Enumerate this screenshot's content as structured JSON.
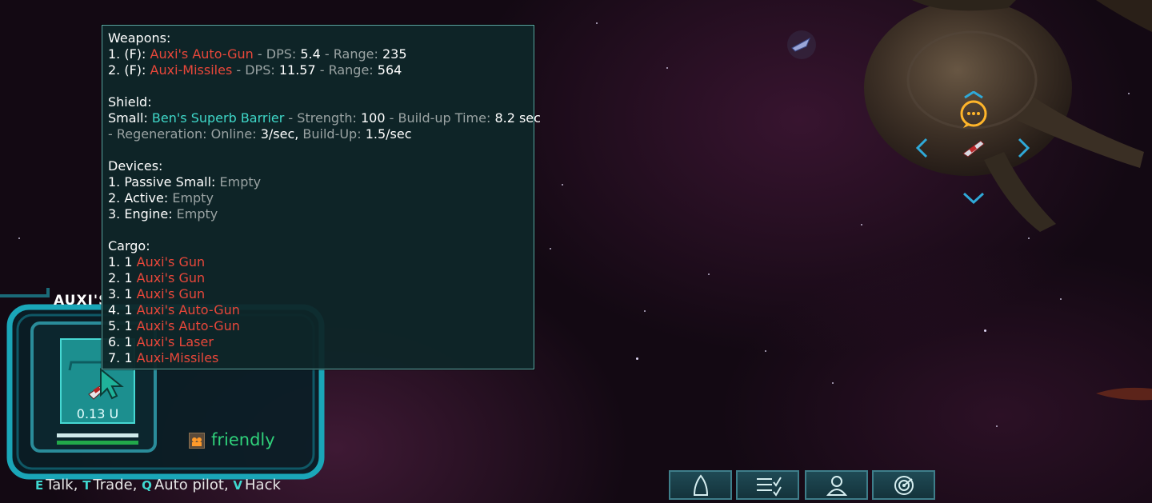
{
  "tooltip": {
    "weapons_header": "Weapons:",
    "weapons": [
      {
        "prefix": "1. (F): ",
        "name": "Auxi's Auto-Gun",
        "dps_label": " - DPS: ",
        "dps": "5.4",
        "range_label": " - Range: ",
        "range": "235"
      },
      {
        "prefix": "2. (F): ",
        "name": "Auxi-Missiles",
        "dps_label": " - DPS: ",
        "dps": "11.57",
        "range_label": " - Range: ",
        "range": "564"
      }
    ],
    "shield_header": "Shield:",
    "shield": {
      "size": "Small: ",
      "name": "Ben's Superb Barrier",
      "strength_label": " - Strength: ",
      "strength": "100",
      "buildup_label": " - Build-up Time: ",
      "buildup": "8.2 sec",
      "regen_label": " - Regeneration: Online: ",
      "regen_online": "3/sec",
      "regen_sep": ", ",
      "regen_buildup_label": "Build-Up: ",
      "regen_buildup": "1.5/sec"
    },
    "devices_header": "Devices:",
    "devices": [
      {
        "label": "1. Passive Small: ",
        "value": "Empty"
      },
      {
        "label": "2. Active: ",
        "value": "Empty"
      },
      {
        "label": "3. Engine: ",
        "value": "Empty"
      }
    ],
    "cargo_header": "Cargo:",
    "cargo": [
      {
        "prefix": "1. 1 ",
        "name": "Auxi's Gun"
      },
      {
        "prefix": "2. 1 ",
        "name": "Auxi's Gun"
      },
      {
        "prefix": "3. 1 ",
        "name": "Auxi's Gun"
      },
      {
        "prefix": "4. 1 ",
        "name": "Auxi's Auto-Gun"
      },
      {
        "prefix": "5. 1 ",
        "name": "Auxi's Auto-Gun"
      },
      {
        "prefix": "6. 1 ",
        "name": "Auxi's Laser"
      },
      {
        "prefix": "7. 1 ",
        "name": "Auxi-Missiles"
      }
    ]
  },
  "target": {
    "title": "AUXI'S",
    "distance": "0.13 U",
    "relation": "friendly",
    "relation_icon": "faction-icon",
    "health_fraction": 1.0,
    "shield_fraction": 1.0
  },
  "hints": [
    {
      "key": "E",
      "label": "Talk,"
    },
    {
      "key": "T",
      "label": "Trade,"
    },
    {
      "key": "Q",
      "label": "Auto pilot,"
    },
    {
      "key": "V",
      "label": "Hack"
    }
  ],
  "hud_buttons": [
    {
      "icon": "ship-icon"
    },
    {
      "icon": "missions-list-icon"
    },
    {
      "icon": "character-icon"
    },
    {
      "icon": "radar-icon"
    }
  ],
  "colors": {
    "hostile_item": "#e8473a",
    "shield_item": "#3fd8c9",
    "friendly": "#2fd07a",
    "accent": "#3fd8d0"
  }
}
